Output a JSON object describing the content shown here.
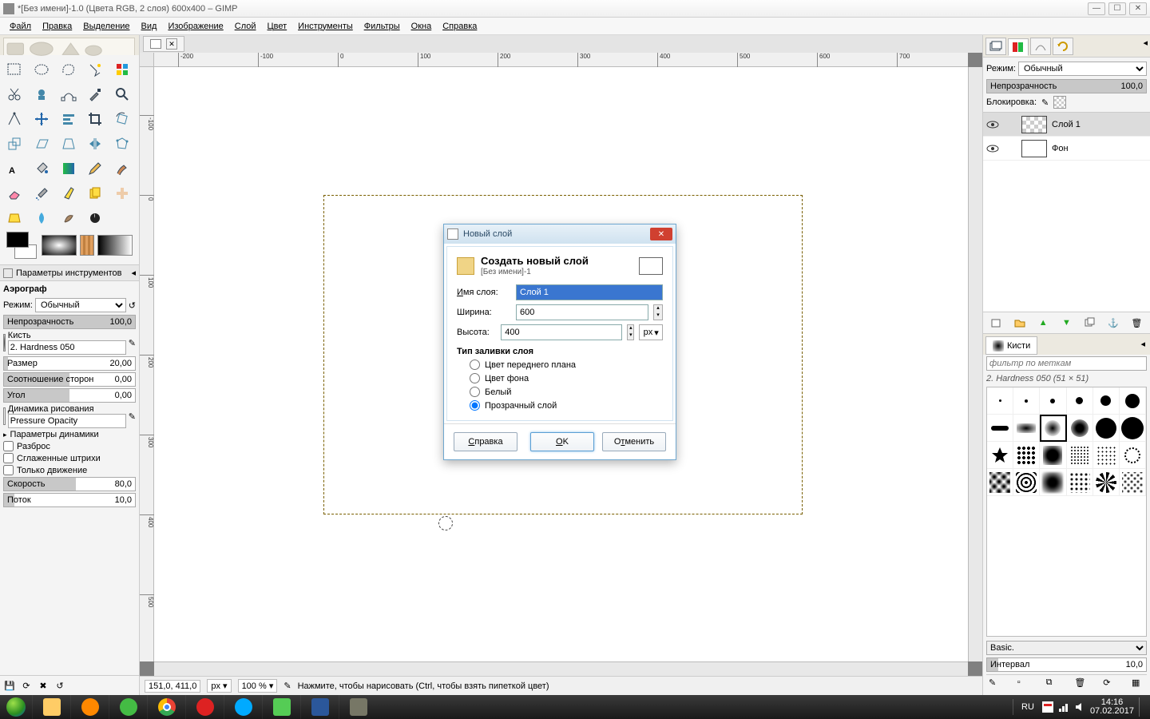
{
  "window": {
    "title": "*[Без имени]-1.0 (Цвета RGB, 2 слоя) 600x400 – GIMP"
  },
  "menu": [
    "Файл",
    "Правка",
    "Выделение",
    "Вид",
    "Изображение",
    "Слой",
    "Цвет",
    "Инструменты",
    "Фильтры",
    "Окна",
    "Справка"
  ],
  "tool_options": {
    "header": "Параметры инструментов",
    "tool_name": "Аэрограф",
    "mode_label": "Режим:",
    "mode_value": "Обычный",
    "opacity_label": "Непрозрачность",
    "opacity_value": "100,0",
    "brush_label": "Кисть",
    "brush_value": "2. Hardness 050",
    "size_label": "Размер",
    "size_value": "20,00",
    "aspect_label": "Соотношение сторон",
    "aspect_value": "0,00",
    "angle_label": "Угол",
    "angle_value": "0,00",
    "dynamics_label": "Динамика рисования",
    "dynamics_value": "Pressure Opacity",
    "dyn_params": "Параметры динамики",
    "scatter": "Разброс",
    "smooth": "Сглаженные штрихи",
    "motion_only": "Только движение",
    "rate_label": "Скорость",
    "rate_value": "80,0",
    "flow_label": "Поток",
    "flow_value": "10,0"
  },
  "layers_panel": {
    "mode_label": "Режим:",
    "mode_value": "Обычный",
    "opacity_label": "Непрозрачность",
    "opacity_value": "100,0",
    "lock_label": "Блокировка:",
    "layers": [
      {
        "name": "Слой 1",
        "transparent": true,
        "selected": true
      },
      {
        "name": "Фон",
        "transparent": false,
        "selected": false
      }
    ]
  },
  "brushes_panel": {
    "tab": "Кисти",
    "filter_placeholder": "фильтр по меткам",
    "current": "2. Hardness 050 (51 × 51)",
    "preset": "Basic.",
    "spacing_label": "Интервал",
    "spacing_value": "10,0"
  },
  "status": {
    "coords": "151,0, 411,0",
    "unit": "px",
    "zoom": "100 %",
    "hint": "Нажмите, чтобы нарисовать (Ctrl, чтобы взять пипеткой цвет)"
  },
  "dialog": {
    "title": "Новый слой",
    "heading": "Создать новый слой",
    "subheading": "[Без имени]-1",
    "name_label": "Имя слоя:",
    "name_value": "Слой 1",
    "width_label": "Ширина:",
    "width_value": "600",
    "height_label": "Высота:",
    "height_value": "400",
    "unit": "px",
    "fill_section": "Тип заливки слоя",
    "fill_options": [
      "Цвет переднего плана",
      "Цвет фона",
      "Белый",
      "Прозрачный слой"
    ],
    "fill_selected": 3,
    "btn_help": "Справка",
    "btn_ok": "OK",
    "btn_cancel": "Отменить"
  },
  "taskbar": {
    "lang": "RU",
    "time": "14:16",
    "date": "07.02.2017"
  }
}
